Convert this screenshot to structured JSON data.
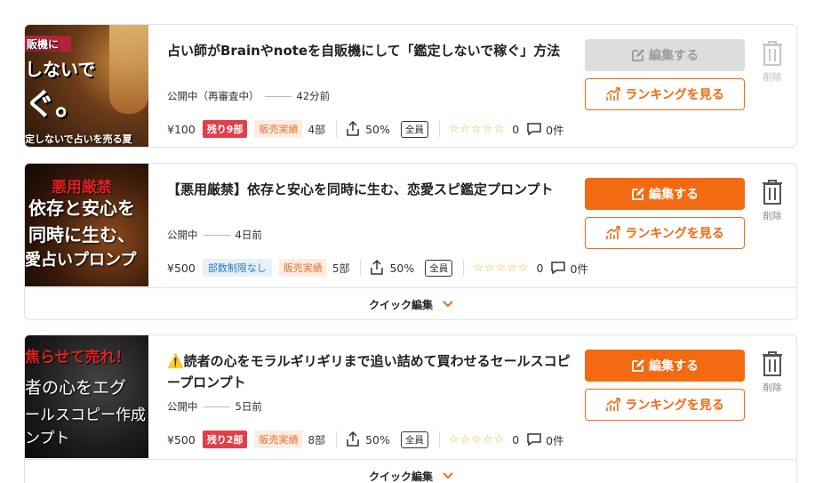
{
  "items": [
    {
      "thumb_lines": [
        "販機に",
        "しないで",
        "ぐ。",
        "定しないで占いを売る夏"
      ],
      "title": "占い師がBrainやnoteを自販機にして「鑑定しないで稼ぐ」方法",
      "status": "公開中（再審査中）",
      "time": "42分前",
      "price": "¥100",
      "stock_badge": "残り9部",
      "stock_type": "red",
      "sales_label": "販売実績",
      "sales_count": "4部",
      "affiliate_pct": "50%",
      "scope": "全員",
      "stars": "☆☆☆☆☆",
      "rating_count": "0",
      "comments": "0件",
      "edit_label": "編集する",
      "edit_disabled": true,
      "rank_label": "ランキングを見る",
      "delete_label": "削除",
      "quick_label": null
    },
    {
      "thumb_lines": [
        "悪用厳禁",
        "依存と安心を",
        "同時に生む、",
        "愛占いプロンプ"
      ],
      "title": "【悪用厳禁】依存と安心を同時に生む、恋愛スピ鑑定プロンプト",
      "status": "公開中",
      "time": "4日前",
      "price": "¥500",
      "stock_badge": "部数制限なし",
      "stock_type": "blue",
      "sales_label": "販売実績",
      "sales_count": "5部",
      "affiliate_pct": "50%",
      "scope": "全員",
      "stars": "☆☆☆☆☆",
      "rating_count": "0",
      "comments": "0件",
      "edit_label": "編集する",
      "edit_disabled": false,
      "rank_label": "ランキングを見る",
      "delete_label": "削除",
      "quick_label": "クイック編集"
    },
    {
      "thumb_lines": [
        "焦らせて売れ！",
        "者の心をエグ",
        "ールスコピー作成",
        "ンプト"
      ],
      "title": "⚠️読者の心をモラルギリギリまで追い詰めて買わせるセールスコピープロンプト",
      "status": "公開中",
      "time": "5日前",
      "price": "¥500",
      "stock_badge": "残り2部",
      "stock_type": "red",
      "sales_label": "販売実績",
      "sales_count": "8部",
      "affiliate_pct": "50%",
      "scope": "全員",
      "stars": "☆☆☆☆☆",
      "rating_count": "0",
      "comments": "0件",
      "edit_label": "編集する",
      "edit_disabled": false,
      "rank_label": "ランキングを見る",
      "delete_label": "削除",
      "quick_label": "クイック編集"
    }
  ],
  "colors": {
    "accent": "#f46a12",
    "danger": "#e0404a",
    "star": "#f0b62a"
  },
  "icons": {
    "edit": "pencil-square-icon",
    "rank": "bar-chart-up-icon",
    "delete": "trash-icon",
    "share": "share-icon",
    "comment": "comment-icon",
    "chevron": "chevron-down-icon"
  }
}
